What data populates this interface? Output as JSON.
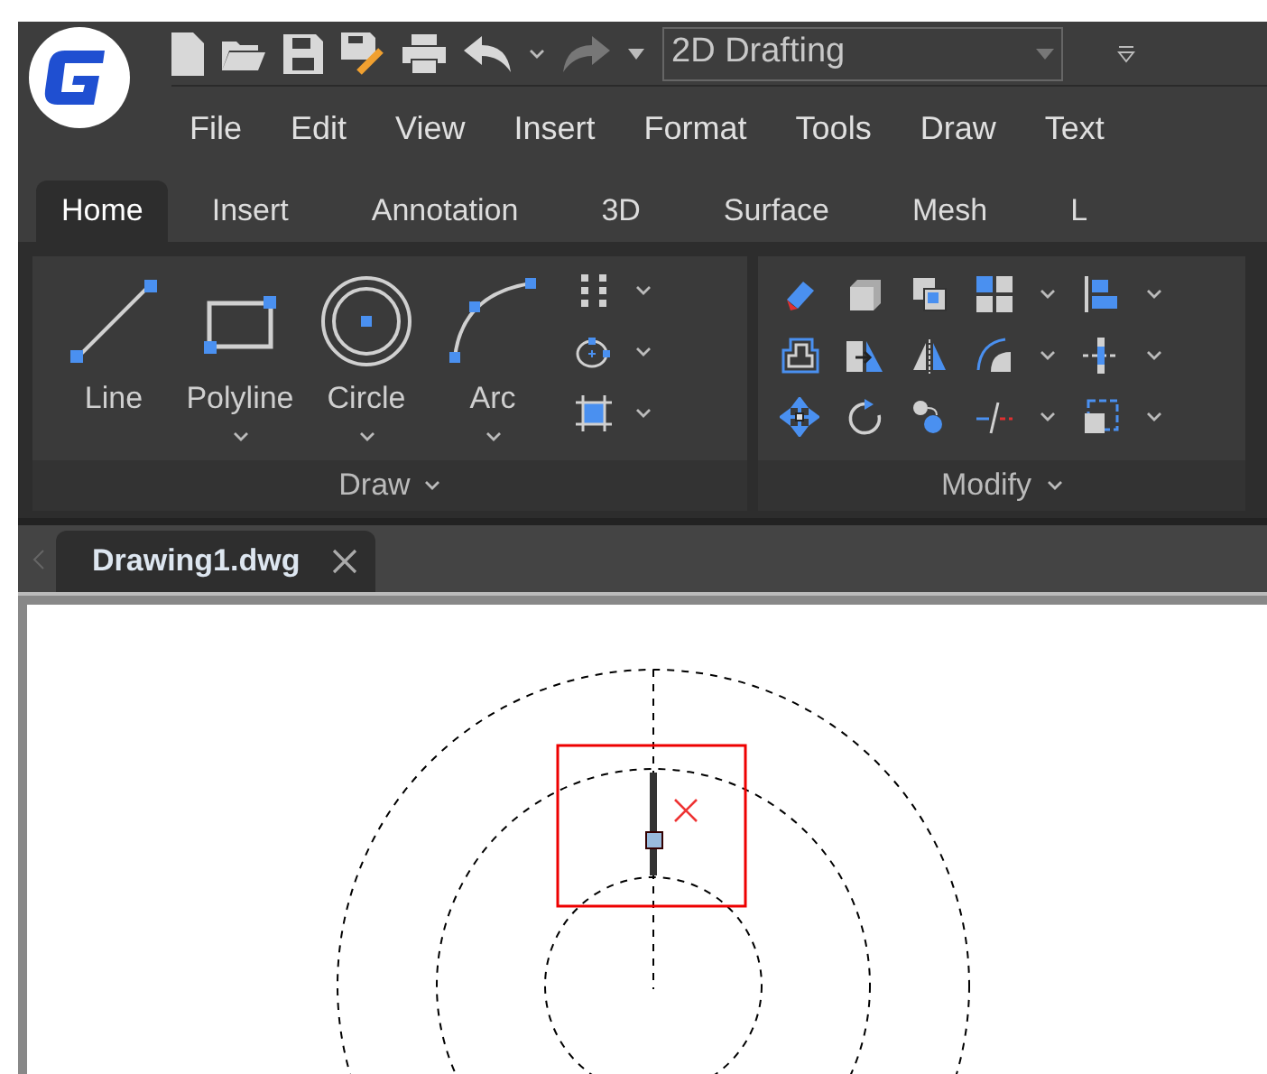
{
  "workspace": {
    "value": "2D Drafting"
  },
  "menu": [
    "File",
    "Edit",
    "View",
    "Insert",
    "Format",
    "Tools",
    "Draw",
    "Text"
  ],
  "tabs": [
    {
      "label": "Home",
      "selected": true
    },
    {
      "label": "Insert",
      "selected": false
    },
    {
      "label": "Annotation",
      "selected": false
    },
    {
      "label": "3D",
      "selected": false
    },
    {
      "label": "Surface",
      "selected": false
    },
    {
      "label": "Mesh",
      "selected": false
    },
    {
      "label": "L",
      "selected": false
    }
  ],
  "ribbon": {
    "draw_panel": {
      "title": "Draw",
      "tools": [
        {
          "kind": "line",
          "label": "Line",
          "dropdown": false
        },
        {
          "kind": "polyline",
          "label": "Polyline",
          "dropdown": true
        },
        {
          "kind": "circle",
          "label": "Circle",
          "dropdown": true
        },
        {
          "kind": "arc",
          "label": "Arc",
          "dropdown": true
        }
      ]
    },
    "modify_panel": {
      "title": "Modify"
    }
  },
  "document_tabs": [
    {
      "label": "Drawing1.dwg",
      "selected": true
    }
  ]
}
